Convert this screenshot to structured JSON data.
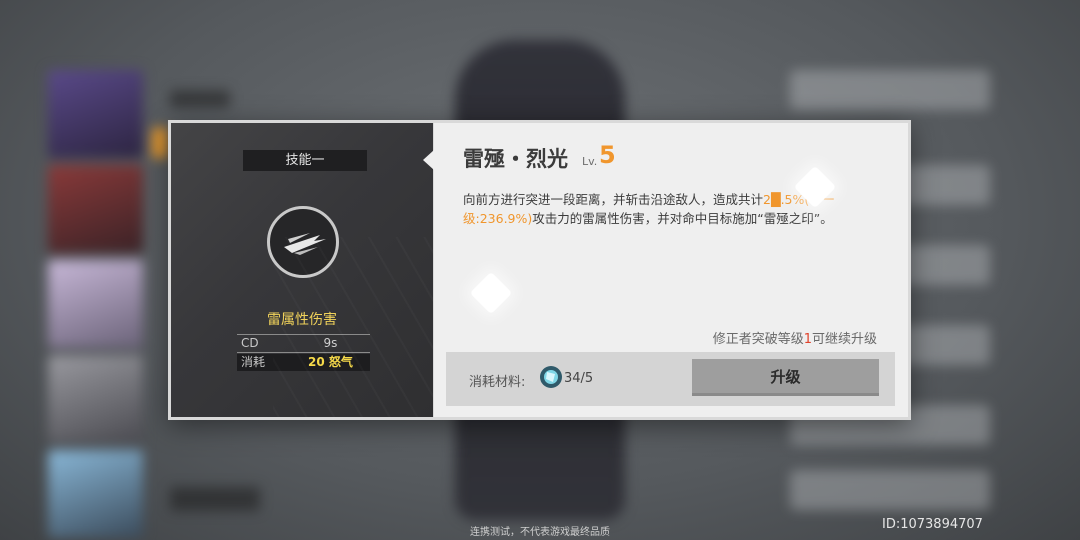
{
  "skill_panel": {
    "tab_label": "技能一",
    "icon": "slash-blade-icon",
    "damage_type": "雷属性伤害",
    "stats": [
      {
        "label": "CD",
        "value": "9s"
      },
      {
        "label": "消耗",
        "value": "20 怒气"
      }
    ]
  },
  "skill_detail": {
    "name": "雷殛・烈光",
    "level_label": "Lv.",
    "level_value": "5",
    "desc_part1": "向前方进行突进一段距离，并斩击沿途敌人，造成共计",
    "desc_highlight": "2█.5%(下一级:236.9%)",
    "desc_part2": "攻击力的雷属性伤害，并对命中目标施加“雷殛之印”。",
    "upgrade_note_prefix": "修正者突破等级",
    "upgrade_note_num": "1",
    "upgrade_note_suffix": "可继续升级",
    "material_label": "消耗材料:",
    "material_icon": "crystal-material-icon",
    "material_count": "34/5",
    "upgrade_button": "升级"
  },
  "footer": {
    "disclaimer": "连携测试，不代表游戏最终品质",
    "uid": "ID:1073894707"
  },
  "colors": {
    "accent_orange": "#f0962d",
    "yellow": "#f5d94a",
    "damage_type": "#f0d25a"
  }
}
